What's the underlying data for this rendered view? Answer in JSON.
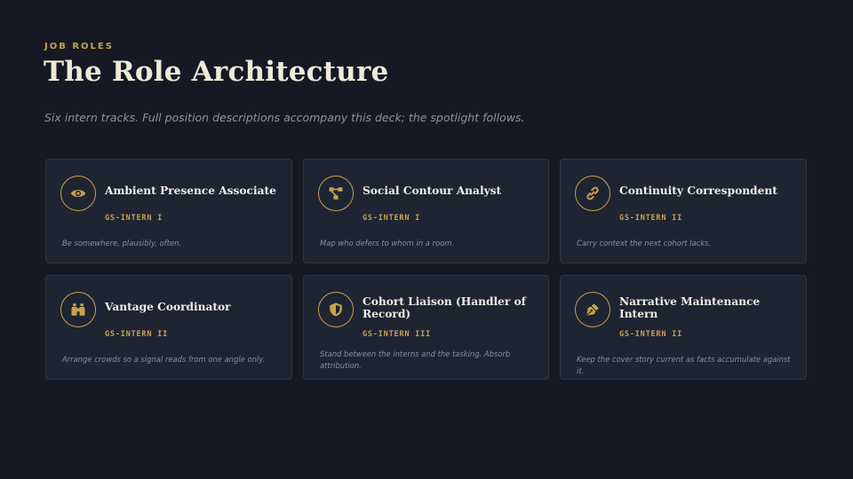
{
  "header": {
    "eyebrow": "JOB ROLES",
    "title": "The Role Architecture",
    "subtitle": "Six intern tracks. Full position descriptions accompany this deck; the spotlight follows."
  },
  "colors": {
    "background": "#161923",
    "card": "#1f2433",
    "accent_gold": "#c9a24a",
    "title_text": "#efe9da"
  },
  "roles": [
    {
      "name": "Ambient Presence Associate",
      "grade": "GS-INTERN I",
      "description": "Be somewhere, plausibly, often.",
      "icon": "eye-icon"
    },
    {
      "name": "Social Contour Analyst",
      "grade": "GS-INTERN I",
      "description": "Map who defers to whom in a room.",
      "icon": "network-icon"
    },
    {
      "name": "Continuity Correspondent",
      "grade": "GS-INTERN II",
      "description": "Carry context the next cohort lacks.",
      "icon": "link-icon"
    },
    {
      "name": "Vantage Coordinator",
      "grade": "GS-INTERN II",
      "description": "Arrange crowds so a signal reads from one angle only.",
      "icon": "binoculars-icon"
    },
    {
      "name": "Cohort Liaison (Handler of Record)",
      "grade": "GS-INTERN III",
      "description": "Stand between the interns and the tasking. Absorb attribution.",
      "icon": "shield-icon"
    },
    {
      "name": "Narrative Maintenance Intern",
      "grade": "GS-INTERN II",
      "description": "Keep the cover story current as facts accumulate against it.",
      "icon": "pen-nib-icon"
    }
  ]
}
